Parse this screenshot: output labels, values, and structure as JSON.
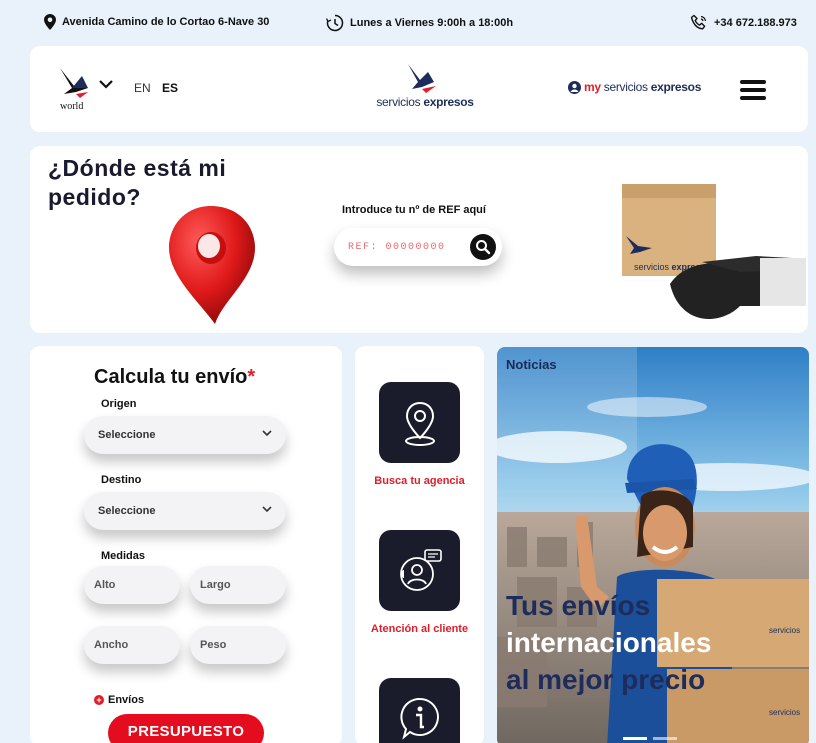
{
  "topbar": {
    "address": "Avenida Camino de lo Cortao 6-Nave 30",
    "hours": "Lunes a Viernes 9:00h a 18:00h",
    "phone": "+34 672.188.973"
  },
  "header": {
    "world_logo_text": "world",
    "lang_en": "EN",
    "lang_es": "ES",
    "brand_light": "servicios ",
    "brand_bold": "expresos",
    "my_prefix": "my",
    "my_brand_light": "servicios ",
    "my_brand_bold": "expresos"
  },
  "tracking": {
    "title": "¿Dónde está mi pedido?",
    "ref_label": "Introduce tu nº de REF aquí",
    "ref_placeholder": "REF: 00000000",
    "box_brand_light": "servicios ",
    "box_brand_bold": "expresos"
  },
  "calculator": {
    "title": "Calcula tu envío",
    "required_mark": "*",
    "origin_label": "Origen",
    "origin_value": "Seleccione",
    "dest_label": "Destino",
    "dest_value": "Seleccione",
    "measures_label": "Medidas",
    "height_placeholder": "Alto",
    "length_placeholder": "Largo",
    "width_placeholder": "Ancho",
    "weight_placeholder": "Peso",
    "shipments_label": "Envíos",
    "quote_button": "PRESUPUESTO"
  },
  "services": {
    "items": [
      {
        "label": "Busca tu agencia",
        "icon": "location-pin-icon"
      },
      {
        "label": "Atención al cliente",
        "icon": "customer-support-icon"
      },
      {
        "label": "",
        "icon": "info-icon"
      }
    ]
  },
  "news": {
    "label": "Noticias",
    "headline_1": "Tus envíos",
    "headline_2": "internacionales",
    "headline_3": "al mejor precio",
    "box_text": "servicios",
    "slide_count": 2,
    "active_slide": 1
  },
  "colors": {
    "accent_red": "#e30d1f",
    "navy": "#1d2c5a",
    "page_bg": "#e9f2fa",
    "tile_dark": "#1a1c2b"
  }
}
